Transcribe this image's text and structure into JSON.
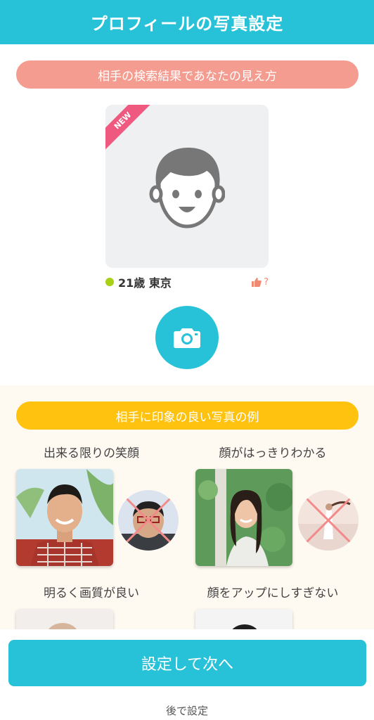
{
  "header": {
    "title": "プロフィールの写真設定"
  },
  "preview": {
    "section_label": "相手の検索結果であなたの見え方",
    "badge": "NEW",
    "age_location": "21歳 東京",
    "like_question": "?"
  },
  "examples": {
    "section_label": "相手に印象の良い写真の例",
    "items": [
      {
        "caption": "出来る限りの笑顔"
      },
      {
        "caption": "顔がはっきりわかる"
      },
      {
        "caption": "明るく画質が良い"
      },
      {
        "caption": "顔をアップにしすぎない"
      }
    ]
  },
  "actions": {
    "next_label": "設定して次へ",
    "later_label": "後で設定"
  },
  "colors": {
    "accent": "#27c2d8",
    "pink_pill": "#f59c90",
    "yellow_pill": "#ffc20e",
    "online": "#a6d116",
    "new_badge": "#f0597f"
  }
}
